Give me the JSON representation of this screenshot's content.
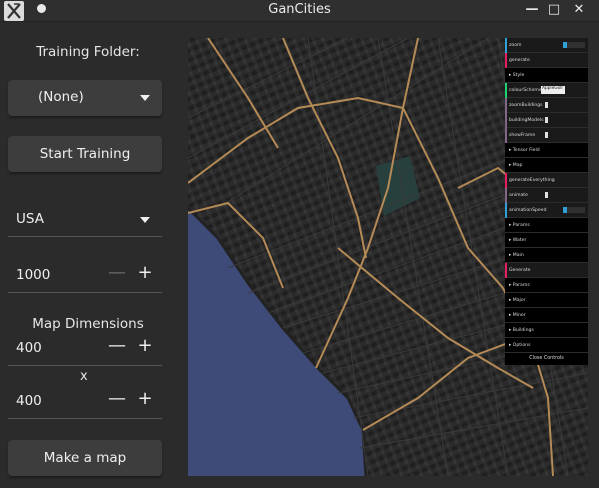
{
  "window": {
    "title": "GanCities",
    "minimize_glyph": "—",
    "maximize_glyph": "□",
    "close_glyph": "✕"
  },
  "left_panel": {
    "training_folder_label": "Training Folder:",
    "training_folder_value": "(None)",
    "start_training_label": "Start Training",
    "country_value": "USA",
    "count_value": "1000",
    "map_dimensions_label": "Map Dimensions",
    "width_value": "400",
    "dimension_separator": "x",
    "height_value": "400",
    "make_map_label": "Make a map",
    "minus_glyph": "—",
    "plus_glyph": "+"
  },
  "gui": {
    "rows": [
      {
        "label": "zoom",
        "kind": "slider",
        "accent": "#2fa1d6"
      },
      {
        "label": "generate",
        "kind": "button",
        "accent": "#e61d5f"
      },
      {
        "label": "▸ Style",
        "kind": "folder"
      },
      {
        "label": "colourScheme",
        "kind": "select",
        "value": "AppleGoll",
        "accent": "#1ed36f"
      },
      {
        "label": "zoomBuildings",
        "kind": "check",
        "accent": "#806787"
      },
      {
        "label": "buildingModels",
        "kind": "check",
        "accent": "#806787"
      },
      {
        "label": "showFrame",
        "kind": "check",
        "accent": "#806787"
      },
      {
        "label": "▸ Tensor Field",
        "kind": "folder"
      },
      {
        "label": "▸ Map",
        "kind": "folder"
      },
      {
        "label": "generateEverything",
        "kind": "button",
        "accent": "#e61d5f"
      },
      {
        "label": "animate",
        "kind": "check",
        "accent": "#806787"
      },
      {
        "label": "animationSpeed",
        "kind": "slider",
        "accent": "#2fa1d6"
      },
      {
        "label": "▸ Params",
        "kind": "folder"
      },
      {
        "label": "▸ Water",
        "kind": "folder"
      },
      {
        "label": "▸ Main",
        "kind": "folder"
      },
      {
        "label": "Generate",
        "kind": "button",
        "accent": "#e61d5f"
      },
      {
        "label": "▸ Params",
        "kind": "folder"
      },
      {
        "label": "▸ Major",
        "kind": "folder"
      },
      {
        "label": "▸ Minor",
        "kind": "folder"
      },
      {
        "label": "▸ Buildings",
        "kind": "folder"
      },
      {
        "label": "▸ Options",
        "kind": "folder"
      }
    ],
    "close_controls_label": "Close Controls"
  },
  "colors": {
    "water": "#3e4a78",
    "park": "#28403d",
    "major_road": "#b48a56",
    "minor_road": "#3a3a3a",
    "block": "#2c2c2c",
    "building": "#1e1e1e"
  }
}
